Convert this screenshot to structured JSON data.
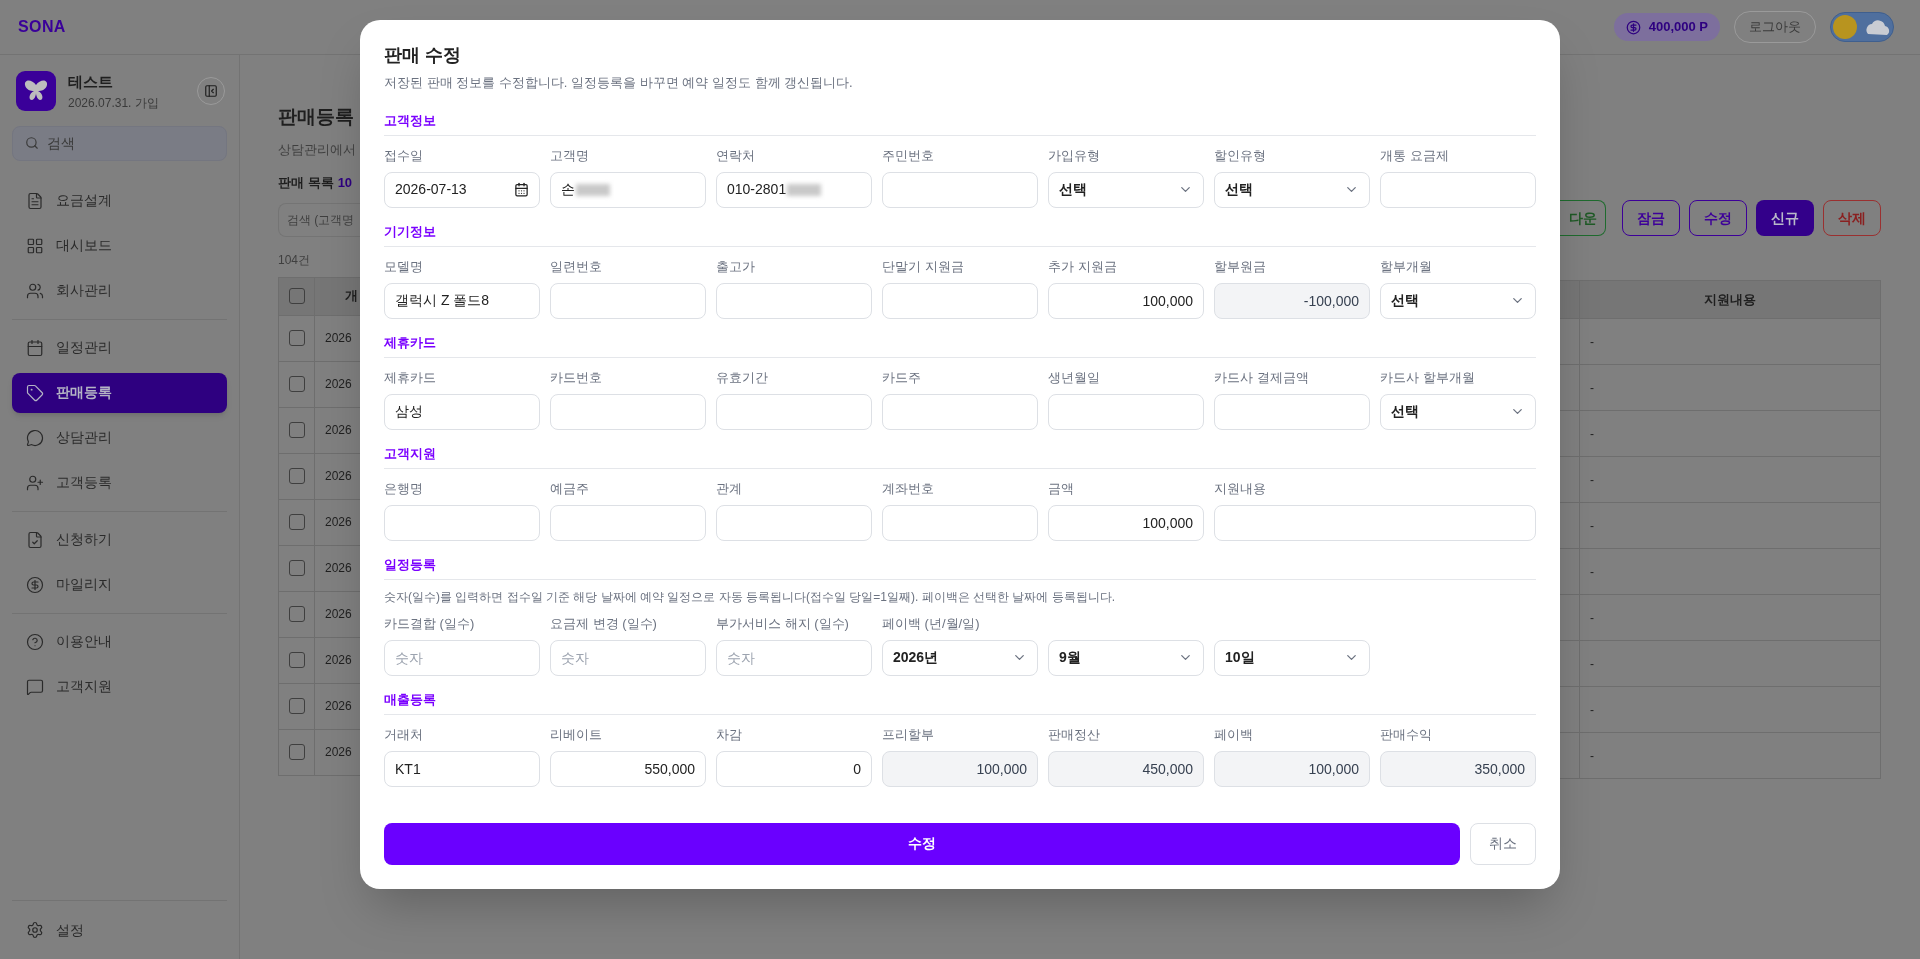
{
  "app": {
    "logo": "SONA"
  },
  "header": {
    "points": "400,000 P",
    "logout": "로그아웃"
  },
  "profile": {
    "name": "테스트",
    "joined": "2026.07.31. 가입"
  },
  "sidebar": {
    "search_placeholder": "검색",
    "groups": [
      [
        {
          "label": "요금설계",
          "selected": false
        },
        {
          "label": "대시보드",
          "selected": false
        },
        {
          "label": "회사관리",
          "selected": false
        }
      ],
      [
        {
          "label": "일정관리",
          "selected": false
        },
        {
          "label": "판매등록",
          "selected": true
        },
        {
          "label": "상담관리",
          "selected": false
        },
        {
          "label": "고객등록",
          "selected": false
        }
      ],
      [
        {
          "label": "신청하기",
          "selected": false
        },
        {
          "label": "마일리지",
          "selected": false
        }
      ],
      [
        {
          "label": "이용안내",
          "selected": false
        },
        {
          "label": "고객지원",
          "selected": false
        }
      ]
    ],
    "settings": "설정"
  },
  "page": {
    "title": "판매등록",
    "subtitle": "상담관리에서",
    "list_title": "판매 목록",
    "list_count": "10",
    "search_placeholder": "검색 (고객명",
    "total": "104건",
    "toolbar": [
      {
        "label": "다운",
        "kind": "success"
      },
      {
        "label": "잠금",
        "kind": "outline"
      },
      {
        "label": "수정",
        "kind": "outline"
      },
      {
        "label": "신규",
        "kind": "primary"
      },
      {
        "label": "삭제",
        "kind": "danger"
      }
    ],
    "table": {
      "column_1": "개",
      "column_last": "지원내용",
      "header_checked": false,
      "rows": [
        {
          "checked": false,
          "column_1": "2026",
          "column_last": "-"
        },
        {
          "checked": false,
          "column_1": "2026",
          "column_last": "-"
        },
        {
          "checked": false,
          "column_1": "2026",
          "column_last": "-"
        },
        {
          "checked": false,
          "column_1": "2026",
          "column_last": "-"
        },
        {
          "checked": false,
          "column_1": "2026",
          "column_last": "-"
        },
        {
          "checked": false,
          "column_1": "2026",
          "column_last": "-"
        },
        {
          "checked": false,
          "column_1": "2026",
          "column_last": "-"
        },
        {
          "checked": false,
          "column_1": "2026",
          "column_last": "-"
        },
        {
          "checked": false,
          "column_1": "2026",
          "column_last": "-"
        },
        {
          "checked": false,
          "column_1": "2026",
          "column_last": "-"
        }
      ]
    }
  },
  "modal": {
    "title": "판매 수정",
    "description": "저장된 판매 정보를 수정합니다. 일정등록을 바꾸면 예약 일정도 함께 갱신됩니다.",
    "sections": [
      {
        "title": "고객정보",
        "fields": [
          {
            "label": "접수일",
            "kind": "date",
            "value": "2026-07-13"
          },
          {
            "label": "고객명",
            "kind": "text",
            "value": "손",
            "masked": true
          },
          {
            "label": "연락처",
            "kind": "text",
            "value": "010-2801",
            "masked": true
          },
          {
            "label": "주민번호",
            "kind": "text"
          },
          {
            "label": "가입유형",
            "kind": "select",
            "value": "선택"
          },
          {
            "label": "할인유형",
            "kind": "select",
            "value": "선택"
          },
          {
            "label": "개통 요금제",
            "kind": "text"
          }
        ]
      },
      {
        "title": "기기정보",
        "fields": [
          {
            "label": "모델명",
            "kind": "text",
            "value": "갤럭시 Z 폴드8"
          },
          {
            "label": "일련번호",
            "kind": "text"
          },
          {
            "label": "출고가",
            "kind": "text"
          },
          {
            "label": "단말기 지원금",
            "kind": "text"
          },
          {
            "label": "추가 지원금",
            "kind": "number",
            "value": "100,000"
          },
          {
            "label": "할부원금",
            "kind": "computed",
            "value": "-100,000"
          },
          {
            "label": "할부개월",
            "kind": "select",
            "value": "선택"
          }
        ]
      },
      {
        "title": "제휴카드",
        "fields": [
          {
            "label": "제휴카드",
            "kind": "text",
            "value": "삼성"
          },
          {
            "label": "카드번호",
            "kind": "text"
          },
          {
            "label": "유효기간",
            "kind": "text"
          },
          {
            "label": "카드주",
            "kind": "text"
          },
          {
            "label": "생년월일",
            "kind": "text"
          },
          {
            "label": "카드사 결제금액",
            "kind": "text"
          },
          {
            "label": "카드사 할부개월",
            "kind": "select",
            "value": "선택"
          }
        ]
      },
      {
        "title": "고객지원",
        "fields": [
          {
            "label": "은행명",
            "kind": "text"
          },
          {
            "label": "예금주",
            "kind": "text"
          },
          {
            "label": "관계",
            "kind": "text"
          },
          {
            "label": "계좌번호",
            "kind": "text"
          },
          {
            "label": "금액",
            "kind": "number",
            "value": "100,000"
          },
          {
            "label": "지원내용",
            "kind": "text",
            "wide": true
          }
        ]
      },
      {
        "title": "일정등록",
        "note": "숫자(일수)를 입력하면 접수일 기준 해당 날짜에 예약 일정으로 자동 등록됩니다(접수일 당일=1일째). 페이백은 선택한 날짜에 등록됩니다.",
        "fields": [
          {
            "label": "카드결합 (일수)",
            "kind": "text",
            "placeholder": "숫자"
          },
          {
            "label": "요금제 변경 (일수)",
            "kind": "text",
            "placeholder": "숫자"
          },
          {
            "label": "부가서비스 해지 (일수)",
            "kind": "text",
            "placeholder": "숫자"
          },
          {
            "label": "페이백 (년/월/일)",
            "kind": "date-select",
            "parts": [
              "2026년",
              "9월",
              "10일"
            ]
          }
        ]
      },
      {
        "title": "매출등록",
        "fields": [
          {
            "label": "거래처",
            "kind": "text",
            "value": "KT1"
          },
          {
            "label": "리베이트",
            "kind": "number",
            "value": "550,000"
          },
          {
            "label": "차감",
            "kind": "number",
            "value": "0"
          },
          {
            "label": "프리할부",
            "kind": "computed",
            "value": "100,000"
          },
          {
            "label": "판매정산",
            "kind": "computed",
            "value": "450,000"
          },
          {
            "label": "페이백",
            "kind": "computed",
            "value": "100,000"
          },
          {
            "label": "판매수익",
            "kind": "computed",
            "value": "350,000"
          }
        ]
      }
    ],
    "submit": "수정",
    "cancel": "취소"
  }
}
